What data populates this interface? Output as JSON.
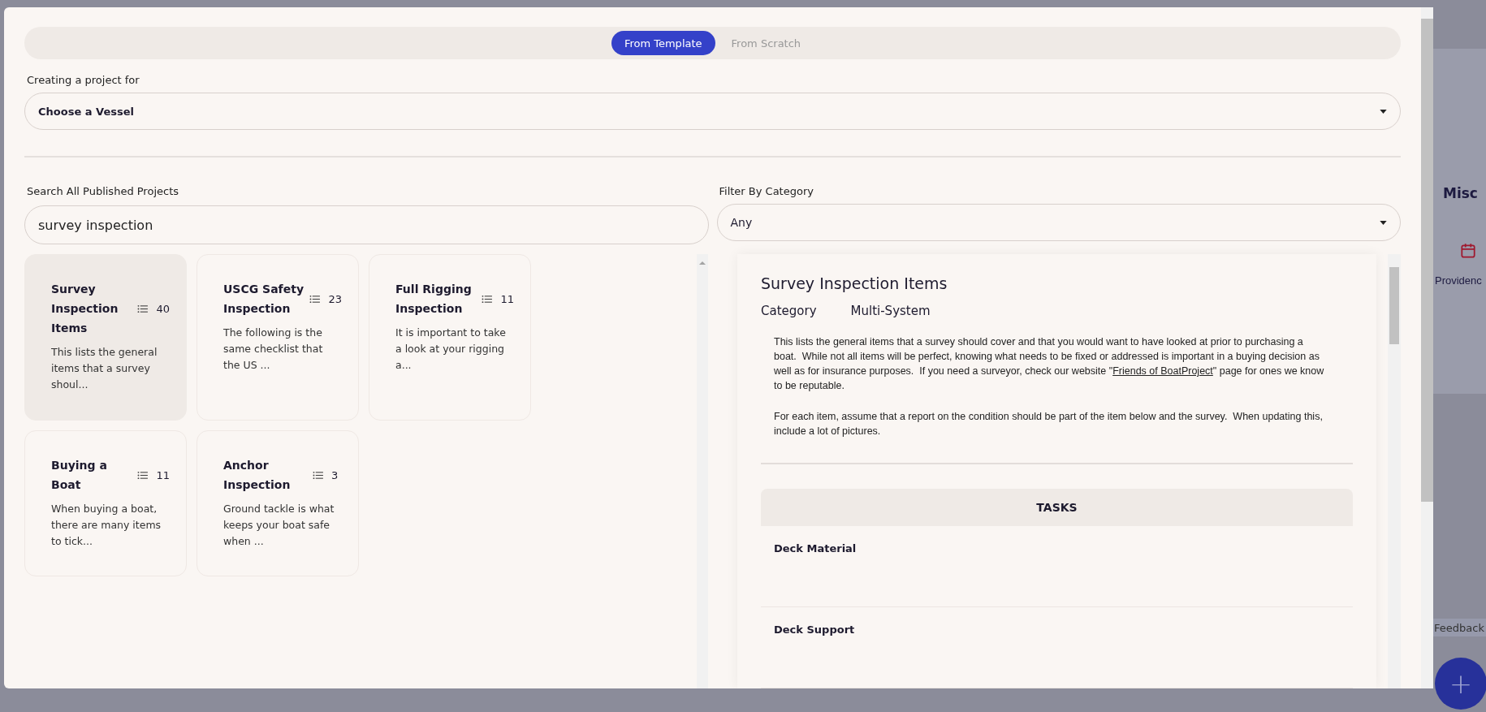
{
  "background": {
    "heading": "Misc",
    "location": "Providenc",
    "feedback": "Feedback",
    "add_button": "+"
  },
  "modal": {
    "tabs": [
      {
        "label": "From Template",
        "selected": true
      },
      {
        "label": "From Scratch",
        "selected": false
      }
    ],
    "vessel_label": "Creating a project for",
    "vessel_select": {
      "value": "Choose a Vessel"
    },
    "search": {
      "label": "Search All Published Projects",
      "value": "survey inspection"
    },
    "filter": {
      "label": "Filter By Category",
      "value": "Any"
    },
    "projects": [
      {
        "title": "Survey Inspection Items",
        "count": "40",
        "description": "This lists the general items that a survey shoul...",
        "selected": true
      },
      {
        "title": "USCG Safety Inspection",
        "count": "23",
        "description": "The following is the same checklist that the US ...",
        "selected": false
      },
      {
        "title": "Full Rigging Inspection",
        "count": "11",
        "description": "It is important to take a look at your rigging a...",
        "selected": false
      },
      {
        "title": "Buying a Boat",
        "count": "11",
        "description": "When buying a boat, there are many items to tick...",
        "selected": false
      },
      {
        "title": "Anchor Inspection",
        "count": "3",
        "description": "Ground tackle is what keeps your boat safe when ...",
        "selected": false
      }
    ],
    "detail": {
      "title": "Survey Inspection Items",
      "category_label": "Category",
      "category": "Multi-System",
      "paragraph_1": {
        "before": "This lists the general items that a survey should cover and that you would want to have looked at prior to purchasing a boat.  While not all items will be perfect, knowing what needs to be fixed or addressed is important in a buying decision as well as for insurance purposes.  If you need a surveyor, check our website \"",
        "link": "Friends of BoatProject",
        "after": "\" page for ones we know to be reputable."
      },
      "paragraph_2": "For each item, assume that a report on the condition should be part of the item below and the survey.  When updating this, include a lot of pictures.",
      "tasks_header": "TASKS",
      "tasks": [
        "Deck Material",
        "Deck Support"
      ]
    }
  }
}
